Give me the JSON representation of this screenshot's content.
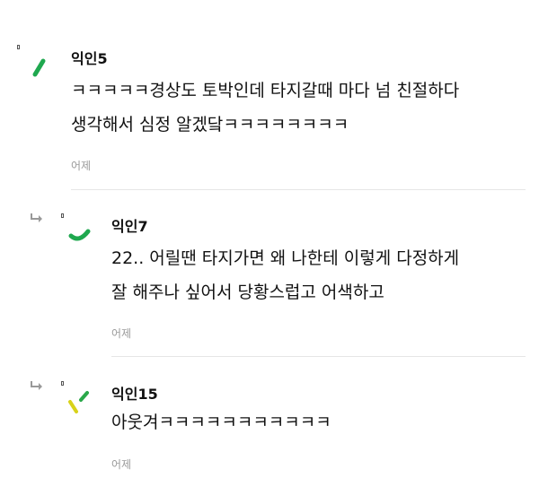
{
  "comments": [
    {
      "author": "익인5",
      "lines": [
        "ㅋㅋㅋㅋㅋ경상도 토박인데 타지갈때 마다 넘 친절하다",
        "생각해서 심정 알겠닼ㅋㅋㅋㅋㅋㅋㅋㅋ"
      ],
      "time": "어제",
      "is_reply": false,
      "avatar_colors": [
        "#1fa84f"
      ]
    },
    {
      "author": "익인7",
      "lines": [
        "22.. 어릴땐 타지가면 왜 나한테 이렇게 다정하게",
        "잘 해주나 싶어서 당황스럽고 어색하고"
      ],
      "time": "어제",
      "is_reply": true,
      "avatar_colors": [
        "#1fa84f"
      ]
    },
    {
      "author": "익인15",
      "lines": [
        "아웃겨ㅋㅋㅋㅋㅋㅋㅋㅋㅋㅋㅋ"
      ],
      "time": "어제",
      "is_reply": true,
      "avatar_colors": [
        "#2aa84a",
        "#d8d21a"
      ]
    }
  ]
}
